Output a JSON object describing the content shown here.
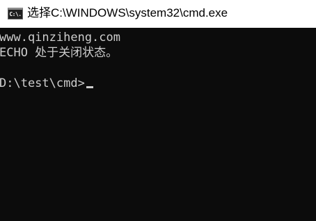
{
  "window": {
    "title": "选择C:\\WINDOWS\\system32\\cmd.exe",
    "icon": "cmd-icon",
    "icon_label": "C:\\."
  },
  "console": {
    "lines": [
      "www.qinziheng.com",
      "ECHO 处于关闭状态。",
      ""
    ],
    "prompt": "D:\\test\\cmd>"
  },
  "colors": {
    "console_bg": "#0c0c0c",
    "console_text": "#cccccc",
    "titlebar_bg": "#ffffff"
  }
}
